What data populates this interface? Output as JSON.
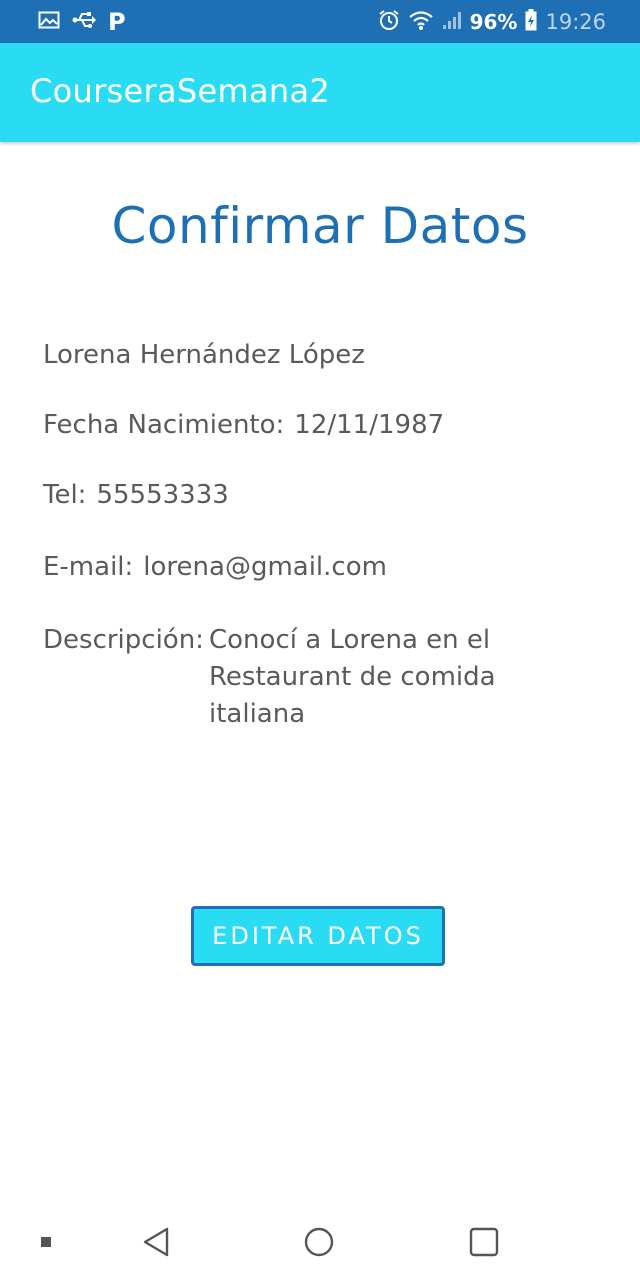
{
  "status_bar": {
    "left_icons": [
      "image-icon",
      "usb-icon",
      "p-icon"
    ],
    "p_label": "P",
    "right_icons": [
      "alarm-icon",
      "wifi-icon",
      "signal-icon",
      "battery-icon"
    ],
    "battery_percent": "96%",
    "time": "19:26"
  },
  "app_bar": {
    "title": "CourseraSemana2"
  },
  "main": {
    "heading": "Confirmar Datos",
    "name": "Lorena Hernández López",
    "birth_label": "Fecha Nacimiento:",
    "birth_value": "12/11/1987",
    "phone_label": "Tel:",
    "phone_value": "55553333",
    "email_label": "E-mail:",
    "email_value": "lorena@gmail.com",
    "description_label": "Descripción:",
    "description_value": "Conocí a Lorena en el Restaurant de comida italiana",
    "edit_button_label": "EDITAR DATOS"
  },
  "nav_bar": {
    "icons": [
      "recent-apps-dot-icon",
      "back-icon",
      "home-icon",
      "overview-icon"
    ]
  },
  "colors": {
    "status_bar": "#1f6fb5",
    "app_bar": "#29dcf4",
    "heading": "#1f6fb5",
    "text": "#5a5a5a"
  }
}
